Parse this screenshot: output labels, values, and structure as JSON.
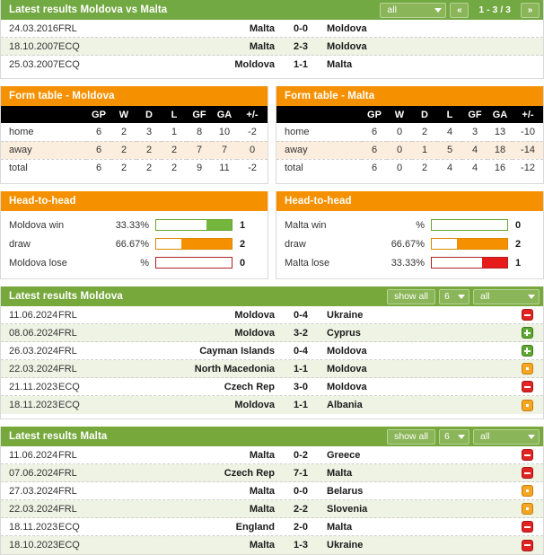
{
  "h2h_header": {
    "title": "Latest results Moldova vs Malta",
    "filter": "all",
    "prev_icon": "«",
    "next_icon": "»",
    "pagination": "1 - 3 / 3"
  },
  "h2h_matches": [
    {
      "date": "24.03.2016",
      "comp": "FRL",
      "home": "Malta",
      "score": "0-0",
      "away": "Moldova"
    },
    {
      "date": "18.10.2007",
      "comp": "ECQ",
      "home": "Malta",
      "score": "2-3",
      "away": "Moldova"
    },
    {
      "date": "25.03.2007",
      "comp": "ECQ",
      "home": "Moldova",
      "score": "1-1",
      "away": "Malta"
    }
  ],
  "form_tables": [
    {
      "title": "Form table - Moldova",
      "columns": [
        "",
        "GP",
        "W",
        "D",
        "L",
        "GF",
        "GA",
        "+/-"
      ],
      "rows": [
        {
          "label": "home",
          "values": [
            "6",
            "2",
            "3",
            "1",
            "8",
            "10",
            "-2"
          ]
        },
        {
          "label": "away",
          "values": [
            "6",
            "2",
            "2",
            "2",
            "7",
            "7",
            "0"
          ]
        },
        {
          "label": "total",
          "values": [
            "6",
            "2",
            "2",
            "2",
            "9",
            "11",
            "-2"
          ]
        }
      ]
    },
    {
      "title": "Form table - Malta",
      "columns": [
        "",
        "GP",
        "W",
        "D",
        "L",
        "GF",
        "GA",
        "+/-"
      ],
      "rows": [
        {
          "label": "home",
          "values": [
            "6",
            "0",
            "2",
            "4",
            "3",
            "13",
            "-10"
          ]
        },
        {
          "label": "away",
          "values": [
            "6",
            "0",
            "1",
            "5",
            "4",
            "18",
            "-14"
          ]
        },
        {
          "label": "total",
          "values": [
            "6",
            "0",
            "2",
            "4",
            "4",
            "16",
            "-12"
          ]
        }
      ]
    }
  ],
  "head_to_head": [
    {
      "title": "Head-to-head",
      "rows": [
        {
          "label": "Moldova win",
          "pct": "33.33%",
          "fill": 33.33,
          "count": "1",
          "kind": "win"
        },
        {
          "label": "draw",
          "pct": "66.67%",
          "fill": 66.67,
          "count": "2",
          "kind": "draw"
        },
        {
          "label": "Moldova lose",
          "pct": "%",
          "fill": 0,
          "count": "0",
          "kind": "lose"
        }
      ]
    },
    {
      "title": "Head-to-head",
      "rows": [
        {
          "label": "Malta win",
          "pct": "%",
          "fill": 0,
          "count": "0",
          "kind": "win"
        },
        {
          "label": "draw",
          "pct": "66.67%",
          "fill": 66.67,
          "count": "2",
          "kind": "draw"
        },
        {
          "label": "Malta lose",
          "pct": "33.33%",
          "fill": 33.33,
          "count": "1",
          "kind": "lose"
        }
      ]
    }
  ],
  "latest": [
    {
      "title": "Latest results Moldova",
      "show_all_label": "show all",
      "count_select": "6",
      "comp_select": "all",
      "matches": [
        {
          "date": "11.06.2024",
          "comp": "FRL",
          "home": "Moldova",
          "score": "0-4",
          "away": "Ukraine",
          "result": "lose"
        },
        {
          "date": "08.06.2024",
          "comp": "FRL",
          "home": "Moldova",
          "score": "3-2",
          "away": "Cyprus",
          "result": "win"
        },
        {
          "date": "26.03.2024",
          "comp": "FRL",
          "home": "Cayman Islands",
          "score": "0-4",
          "away": "Moldova",
          "result": "win"
        },
        {
          "date": "22.03.2024",
          "comp": "FRL",
          "home": "North Macedonia",
          "score": "1-1",
          "away": "Moldova",
          "result": "draw"
        },
        {
          "date": "21.11.2023",
          "comp": "ECQ",
          "home": "Czech Rep",
          "score": "3-0",
          "away": "Moldova",
          "result": "lose"
        },
        {
          "date": "18.11.2023",
          "comp": "ECQ",
          "home": "Moldova",
          "score": "1-1",
          "away": "Albania",
          "result": "draw"
        }
      ]
    },
    {
      "title": "Latest results Malta",
      "show_all_label": "show all",
      "count_select": "6",
      "comp_select": "all",
      "matches": [
        {
          "date": "11.06.2024",
          "comp": "FRL",
          "home": "Malta",
          "score": "0-2",
          "away": "Greece",
          "result": "lose"
        },
        {
          "date": "07.06.2024",
          "comp": "FRL",
          "home": "Czech Rep",
          "score": "7-1",
          "away": "Malta",
          "result": "lose"
        },
        {
          "date": "27.03.2024",
          "comp": "FRL",
          "home": "Malta",
          "score": "0-0",
          "away": "Belarus",
          "result": "draw"
        },
        {
          "date": "22.03.2024",
          "comp": "FRL",
          "home": "Malta",
          "score": "2-2",
          "away": "Slovenia",
          "result": "draw"
        },
        {
          "date": "18.11.2023",
          "comp": "ECQ",
          "home": "England",
          "score": "2-0",
          "away": "Malta",
          "result": "lose"
        },
        {
          "date": "18.10.2023",
          "comp": "ECQ",
          "home": "Malta",
          "score": "1-3",
          "away": "Ukraine",
          "result": "lose"
        }
      ]
    }
  ],
  "colors": {
    "green_bar": "#73a942",
    "orange_bar": "#f59100",
    "alt_row": "#eef3e4",
    "form_alt_row": "#fceede",
    "win": "#5fa832",
    "lose": "#e02424",
    "draw": "#f6a623"
  }
}
